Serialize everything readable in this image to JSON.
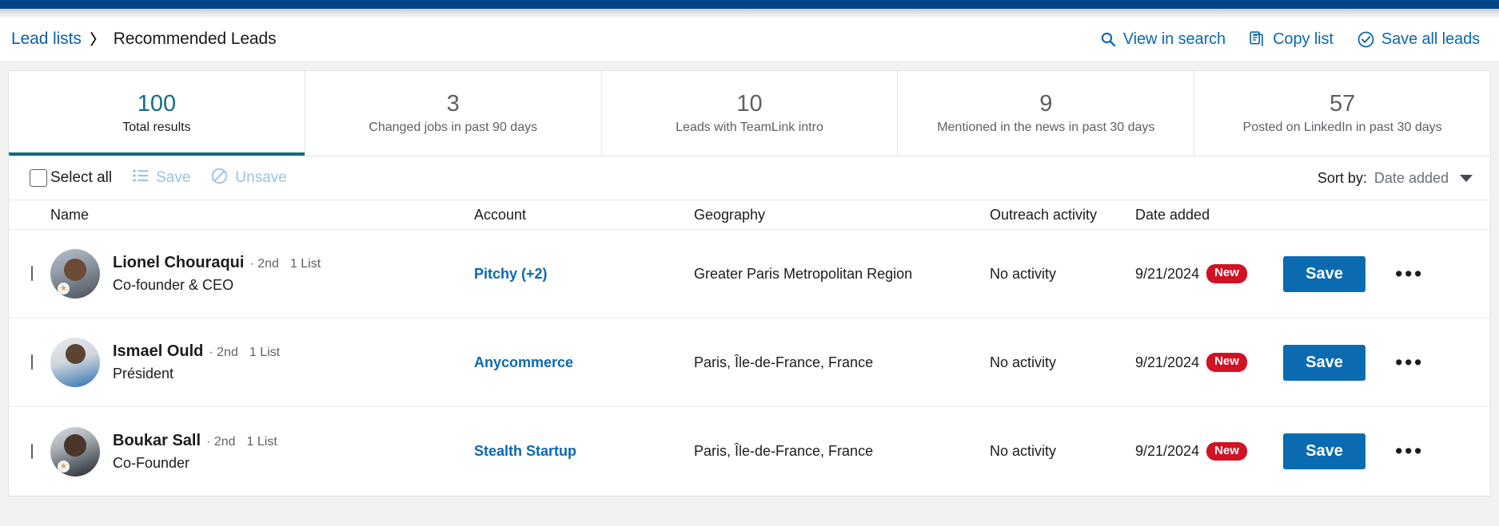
{
  "breadcrumb": {
    "parent": "Lead lists",
    "separator": "〉",
    "current": "Recommended Leads"
  },
  "header_actions": [
    {
      "label": "View in search",
      "icon": "search-icon"
    },
    {
      "label": "Copy list",
      "icon": "copy-icon"
    },
    {
      "label": "Save all leads",
      "icon": "check-circle-icon"
    }
  ],
  "stats": [
    {
      "value": "100",
      "label": "Total results",
      "active": true
    },
    {
      "value": "3",
      "label": "Changed jobs in past 90 days",
      "active": false
    },
    {
      "value": "10",
      "label": "Leads with TeamLink intro",
      "active": false
    },
    {
      "value": "9",
      "label": "Mentioned in the news in past 30 days",
      "active": false
    },
    {
      "value": "57",
      "label": "Posted on LinkedIn in past 30 days",
      "active": false
    }
  ],
  "toolbar": {
    "select_all": "Select all",
    "save_label": "Save",
    "unsave_label": "Unsave",
    "sort_label": "Sort by:",
    "sort_value": "Date added"
  },
  "columns": {
    "name": "Name",
    "account": "Account",
    "geography": "Geography",
    "outreach": "Outreach activity",
    "date_added": "Date added"
  },
  "rows": [
    {
      "name": "Lionel Chouraqui",
      "degree": "· 2nd",
      "lists": "1 List",
      "title": "Co-founder & CEO",
      "account": "Pitchy (+2)",
      "geography": "Greater Paris Metropolitan Region",
      "outreach": "No activity",
      "date": "9/21/2024",
      "badge": "New",
      "save": "Save",
      "more": "•••"
    },
    {
      "name": "Ismael Ould",
      "degree": "· 2nd",
      "lists": "1 List",
      "title": "Président",
      "account": "Anycommerce",
      "geography": "Paris, Île-de-France, France",
      "outreach": "No activity",
      "date": "9/21/2024",
      "badge": "New",
      "save": "Save",
      "more": "•••"
    },
    {
      "name": "Boukar Sall",
      "degree": "· 2nd",
      "lists": "1 List",
      "title": "Co-Founder",
      "account": "Stealth Startup",
      "geography": "Paris, Île-de-France, France",
      "outreach": "No activity",
      "date": "9/21/2024",
      "badge": "New",
      "save": "Save",
      "more": "•••"
    }
  ],
  "colors": {
    "topbar": "#034584",
    "link": "#0b68b1",
    "accent_teal": "#10707c",
    "save_button": "#0b6bb0",
    "badge_red": "#d11124"
  }
}
